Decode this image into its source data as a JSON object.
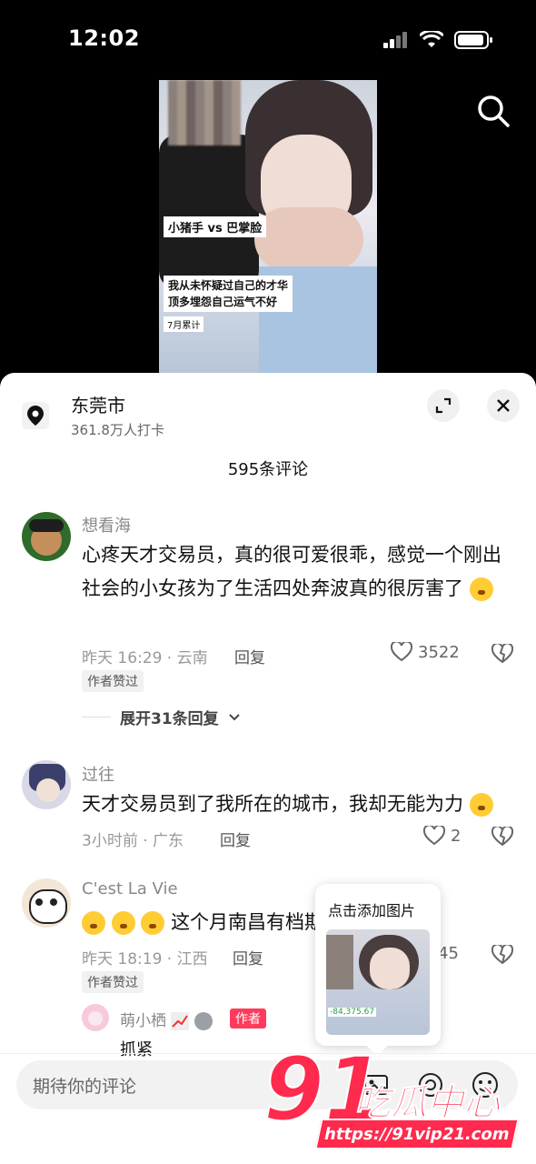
{
  "status": {
    "time": "12:02"
  },
  "video": {
    "tag_title": "小猪手 vs 巴掌脸",
    "caption_line1": "我从未怀疑过自己的才华",
    "caption_line2": "顶多埋怨自己运气不好",
    "caption_line3": "7月累计"
  },
  "location": {
    "title": "东莞市",
    "subtitle": "361.8万人打卡"
  },
  "comments_count": "595条评论",
  "comments": [
    {
      "user": "想看海",
      "text": "心疼天才交易员，真的很可爱很乖，感觉一个刚出社会的小女孩为了生活四处奔波真的很厉害了",
      "time_place": "昨天 16:29 · 云南",
      "reply_label": "回复",
      "likes": "3522",
      "badge": "作者赞过",
      "expand_label": "展开31条回复"
    },
    {
      "user": "过往",
      "text": "天才交易员到了我所在的城市，我却无能为力",
      "time_place": "3小时前 · 广东",
      "reply_label": "回复",
      "likes": "2"
    },
    {
      "user": "C'est La Vie",
      "text": "这个月南昌有档期",
      "time_place": "昨天 18:19 · 江西",
      "reply_label": "回复",
      "likes": "45",
      "badge": "作者赞过"
    }
  ],
  "sub_reply": {
    "user": "萌小栖",
    "author_tag": "作者",
    "text": "抓紧"
  },
  "tooltip": {
    "label": "点击添加图片",
    "img_overlay": "-84,375.67"
  },
  "input": {
    "placeholder": "期待你的评论"
  },
  "watermark": {
    "number": "91",
    "chinese": "吃瓜中心",
    "url": "https://91vip21.com"
  }
}
